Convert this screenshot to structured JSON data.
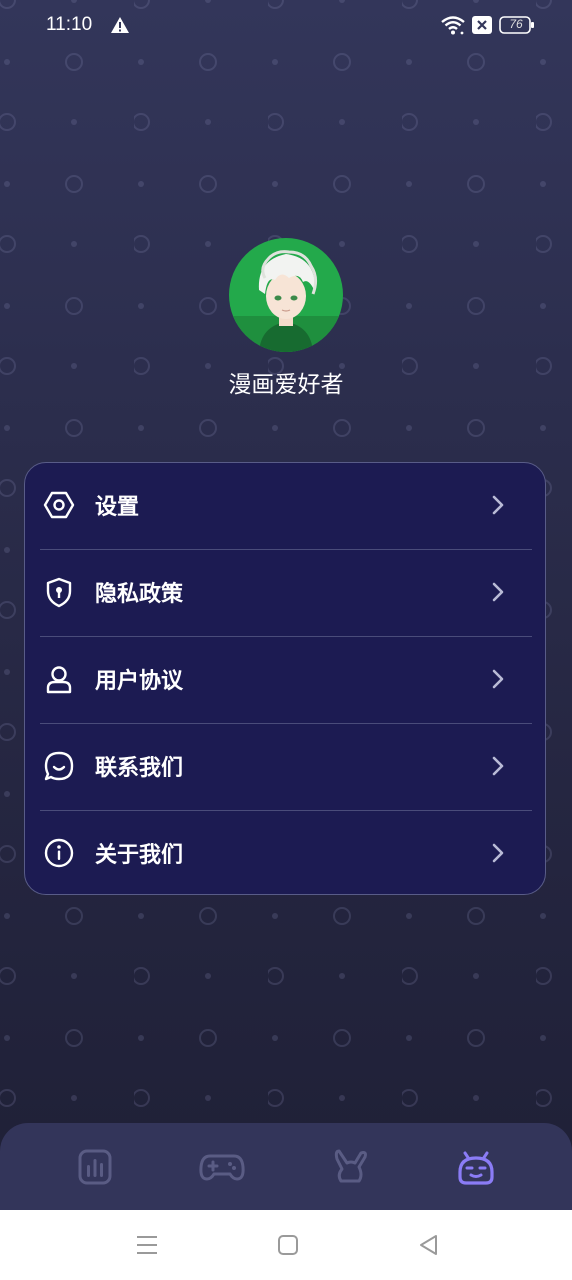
{
  "status_bar": {
    "time": "11:10",
    "battery": "76"
  },
  "profile": {
    "username": "漫画爱好者"
  },
  "menu": {
    "items": [
      {
        "label": "设置",
        "icon": "hexagon-settings-icon"
      },
      {
        "label": "隐私政策",
        "icon": "shield-keyhole-icon"
      },
      {
        "label": "用户协议",
        "icon": "user-icon"
      },
      {
        "label": "联系我们",
        "icon": "chat-bubble-icon"
      },
      {
        "label": "关于我们",
        "icon": "info-icon"
      }
    ]
  },
  "tabbar": {
    "tabs": [
      "chart-icon",
      "gamepad-icon",
      "rabbit-icon",
      "robot-face-icon"
    ],
    "active_color": "#8b7cf6",
    "inactive_color": "#5a5c84"
  },
  "colors": {
    "card_bg": "#1c1b52",
    "card_border": "#595c88"
  }
}
